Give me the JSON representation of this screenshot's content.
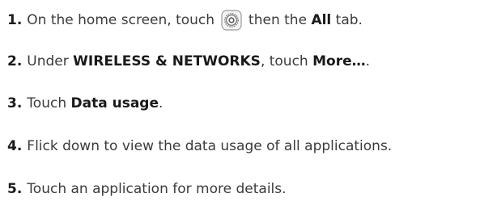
{
  "steps": [
    {
      "number": "1.",
      "text_before": "On the home screen, touch",
      "icon": "settings-gear-icon",
      "text_middle": "then the",
      "bold": "All",
      "text_after": "tab."
    },
    {
      "number": "2.",
      "text_before": "Under",
      "bold1": "WIRELESS & NETWORKS",
      "text_middle": ", touch",
      "bold2": "More…",
      "text_after": "."
    },
    {
      "number": "3.",
      "text_before": "Touch",
      "bold": "Data usage",
      "text_after": "."
    },
    {
      "number": "4.",
      "text": "Flick down to view the data usage of all applications."
    },
    {
      "number": "5.",
      "text": "Touch an application for more details."
    }
  ]
}
